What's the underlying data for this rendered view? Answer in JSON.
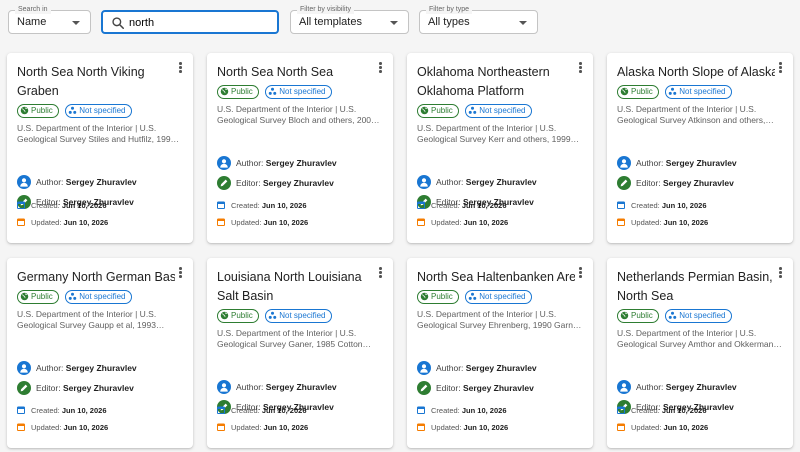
{
  "filters": {
    "sort": {
      "legend": "Search in",
      "value": "Name"
    },
    "search": {
      "value": "north"
    },
    "visibility": {
      "legend": "Filter by visibility",
      "value": "All templates"
    },
    "type": {
      "legend": "Filter by type",
      "value": "All types"
    }
  },
  "labels": {
    "public": "Public",
    "not_specified": "Not specified",
    "author_prefix": "Author:",
    "editor_prefix": "Editor:",
    "created_prefix": "Created:",
    "updated_prefix": "Updated:"
  },
  "colors": {
    "accent": "#1976d2",
    "public_green": "#2e7d32",
    "created_icon": "#1976d2",
    "updated_icon": "#f57c00"
  },
  "cards": [
    {
      "title": "North Sea North Viking Graben",
      "description": "U.S. Department of the Interior | U.S. Geological Survey Stiles and Hutfilz, 199…",
      "author": "Sergey Zhuravlev",
      "editor": "Sergey Zhuravlev",
      "created": "Jun 10, 2026",
      "updated": "Jun 10, 2026"
    },
    {
      "title": "North Sea North Sea",
      "description": "U.S. Department of the Interior | U.S. Geological Survey Bloch and others, 200…",
      "author": "Sergey Zhuravlev",
      "editor": "Sergey Zhuravlev",
      "created": "Jun 10, 2026",
      "updated": "Jun 10, 2026"
    },
    {
      "title": "Oklahoma Northeastern Oklahoma Platform",
      "description": "U.S. Department of the Interior | U.S. Geological Survey Kerr and others, 1999…",
      "author": "Sergey Zhuravlev",
      "editor": "Sergey Zhuravlev",
      "created": "Jun 10, 2026",
      "updated": "Jun 10, 2026"
    },
    {
      "title": "Alaska North Slope of Alaska",
      "description": "U.S. Department of the Interior | U.S. Geological Survey Atkinson and others,…",
      "author": "Sergey Zhuravlev",
      "editor": "Sergey Zhuravlev",
      "created": "Jun 10, 2026",
      "updated": "Jun 10, 2026"
    },
    {
      "title": "Germany North German Basin",
      "description": "U.S. Department of the Interior | U.S. Geological Survey Gaupp et al, 1993…",
      "author": "Sergey Zhuravlev",
      "editor": "Sergey Zhuravlev",
      "created": "Jun 10, 2026",
      "updated": "Jun 10, 2026"
    },
    {
      "title": "Louisiana North Louisiana Salt Basin",
      "description": "U.S. Department of the Interior | U.S. Geological Survey Ganer, 1985 Cotton…",
      "author": "Sergey Zhuravlev",
      "editor": "Sergey Zhuravlev",
      "created": "Jun 10, 2026",
      "updated": "Jun 10, 2026"
    },
    {
      "title": "North Sea Haltenbanken Area",
      "description": "U.S. Department of the Interior | U.S. Geological Survey Ehrenberg, 1990 Garn…",
      "author": "Sergey Zhuravlev",
      "editor": "Sergey Zhuravlev",
      "created": "Jun 10, 2026",
      "updated": "Jun 10, 2026"
    },
    {
      "title": "Netherlands Permian Basin, North Sea",
      "description": "U.S. Department of the Interior | U.S. Geological Survey Amthor and Okkerman…",
      "author": "Sergey Zhuravlev",
      "editor": "Sergey Zhuravlev",
      "created": "Jun 10, 2026",
      "updated": "Jun 10, 2026"
    }
  ]
}
